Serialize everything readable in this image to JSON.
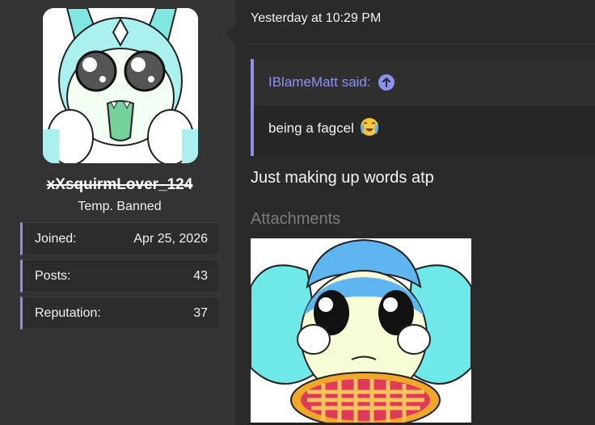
{
  "user": {
    "avatar_icon": "user-avatar-image",
    "username": "xXsquirmLover_124",
    "title": "Temp. Banned",
    "stats": [
      {
        "label": "Joined:",
        "value": "Apr 25, 2026"
      },
      {
        "label": "Posts:",
        "value": "43"
      },
      {
        "label": "Reputation:",
        "value": "37"
      }
    ]
  },
  "message": {
    "timestamp": "Yesterday at 10:29 PM",
    "quote": {
      "author": "IBlameMatt said:",
      "jump_icon": "arrow-up-circle-icon",
      "text": "being a fagcel",
      "emoji": "crying-face-emoji"
    },
    "body": "Just making up words atp",
    "attachments_label": "Attachments",
    "attachment_icon": "attachment-image"
  },
  "colors": {
    "accent": "#8f8fe8",
    "link": "#8a93f0",
    "panel_left": "#333333",
    "panel_right": "#2a2a2a"
  }
}
